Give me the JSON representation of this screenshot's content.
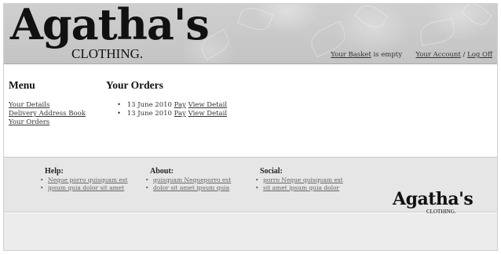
{
  "header": {
    "logo_main": "Agatha's",
    "logo_sub": "CLOTHING.",
    "basket_link": "Your Basket",
    "basket_status": "is empty",
    "account_link": "Your Account",
    "separator": "/",
    "logoff_link": "Log Off"
  },
  "menu": {
    "title": "Menu",
    "items": [
      {
        "label": "Your Details"
      },
      {
        "label": "Delivery Address Book"
      },
      {
        "label": "Your Orders"
      }
    ]
  },
  "orders": {
    "title": "Your Orders",
    "items": [
      {
        "date": "13 June 2010",
        "pay": "Pay",
        "view": "View Detail"
      },
      {
        "date": "13 June 2010",
        "pay": "Pay",
        "view": "View Detail"
      }
    ]
  },
  "footer": {
    "help": {
      "title": "Help:",
      "items": [
        {
          "label": "Neque porro quisquam est"
        },
        {
          "label": "ipsum quia dolor sit amet"
        }
      ]
    },
    "about": {
      "title": "About:",
      "items": [
        {
          "label": "quisquam Nequeporro est"
        },
        {
          "label": "dolor sit amet ipsum quia"
        }
      ]
    },
    "social": {
      "title": "Social:",
      "items": [
        {
          "label": "porro Neque quisquam est"
        },
        {
          "label": "sit amet ipsum quia dolor"
        }
      ]
    },
    "logo_main": "Agatha's",
    "logo_sub": "CLOTHING."
  },
  "bullet": "•"
}
